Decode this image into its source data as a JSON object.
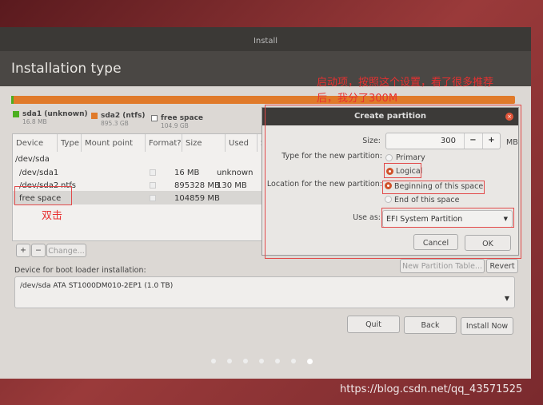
{
  "window": {
    "title": "Install",
    "page_title": "Installation type"
  },
  "legend": [
    {
      "name": "sda1 (unknown)",
      "size": "16.8 MB",
      "color": "#4caf20"
    },
    {
      "name": "sda2 (ntfs)",
      "size": "895.3 GB",
      "color": "#e07a2a"
    },
    {
      "name": "free space",
      "size": "104.9 GB",
      "color": "#ffffff"
    }
  ],
  "table": {
    "headers": [
      "Device",
      "Type",
      "Mount point",
      "Format?",
      "Size",
      "Used",
      "S"
    ],
    "rows": [
      {
        "device": "/dev/sda",
        "type": "",
        "size": "",
        "used": ""
      },
      {
        "device": "/dev/sda1",
        "type": "",
        "size": "16 MB",
        "used": "unknown"
      },
      {
        "device": "/dev/sda2",
        "type": "ntfs",
        "size": "895328 MB",
        "used": "130 MB"
      },
      {
        "device": "free space",
        "type": "",
        "size": "104859 MB",
        "used": ""
      }
    ]
  },
  "buttons": {
    "add": "+",
    "remove": "−",
    "change": "Change...",
    "new_table": "New Partition Table...",
    "revert": "Revert",
    "quit": "Quit",
    "back": "Back",
    "install": "Install Now"
  },
  "bootloader": {
    "label": "Device for boot loader installation:",
    "value": "/dev/sda   ATA ST1000DM010-2EP1 (1.0 TB)"
  },
  "dialog": {
    "title": "Create partition",
    "size_label": "Size:",
    "size_value": "300",
    "minus": "−",
    "plus": "+",
    "unit": "MB",
    "type_label": "Type for the new partition:",
    "type_options": [
      "Primary",
      "Logical"
    ],
    "type_selected": "Logical",
    "location_label": "Location for the new partition:",
    "location_options": [
      "Beginning of this space",
      "End of this space"
    ],
    "location_selected": "Beginning of this space",
    "use_as_label": "Use as:",
    "use_as_value": "EFI System Partition",
    "cancel": "Cancel",
    "ok": "OK"
  },
  "annotations": {
    "top_line1": "启动项，按照这个设置，看了很多推荐",
    "top_line2": "后，我分了300M",
    "double_click": "双击"
  },
  "progress_dots": {
    "total": 8,
    "current": 7
  },
  "watermark": "https://blog.csdn.net/qq_43571525"
}
